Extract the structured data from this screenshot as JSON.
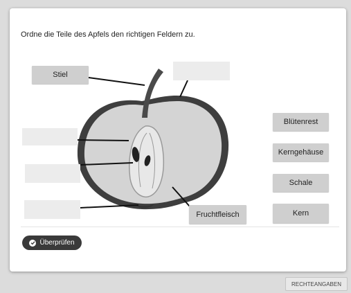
{
  "instruction": "Ordne die Teile des Apfels den richtigen Feldern zu.",
  "labels": {
    "stiel": "Stiel",
    "bluetenrest": "Blütenrest",
    "kerngehaeuse": "Kerngehäuse",
    "schale": "Schale",
    "kern": "Kern",
    "fruchtfleisch": "Fruchtfleisch"
  },
  "check_button": {
    "label": "Überprüfen",
    "icon": "check-circle-icon"
  },
  "footer": {
    "rights_button": "RECHTEANGABEN"
  }
}
